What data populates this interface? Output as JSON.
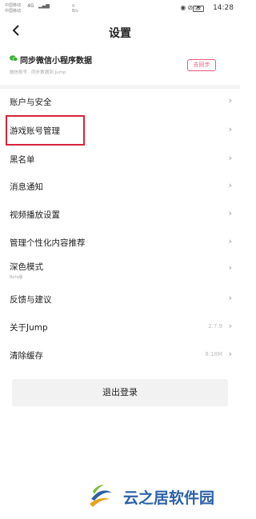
{
  "status_bar": {
    "carrier_1": "中国移动",
    "carrier_2": "中国移动",
    "signal_1": "4G",
    "net_speed_value": "0",
    "net_speed_unit": "B/s",
    "battery": "42",
    "time": "14:28"
  },
  "header": {
    "back_icon": "chevron-left",
    "title": "设置"
  },
  "sync": {
    "title": "同步微信小程序数据",
    "subtitle": "微信账号 · 同步数据到 Jump",
    "button": "去同步",
    "icon": "wechat-icon"
  },
  "menu": [
    {
      "label": "账户与安全",
      "value": ""
    },
    {
      "label": "游戏账号管理",
      "value": ""
    },
    {
      "label": "黑名单",
      "value": ""
    },
    {
      "label": "消息通知",
      "value": ""
    },
    {
      "label": "视频播放设置",
      "value": ""
    },
    {
      "label": "管理个性化内容推荐",
      "value": ""
    },
    {
      "label": "深色模式",
      "sub": "Beta版",
      "value": ""
    },
    {
      "label": "反馈与建议",
      "value": ""
    },
    {
      "label": "关于Jump",
      "value": "2.7.9"
    },
    {
      "label": "清除缓存",
      "value": "8.18M"
    }
  ],
  "logout": "退出登录",
  "watermark": {
    "text": "云之居软件园"
  },
  "colors": {
    "accent": "#e85a7c",
    "highlight": "#d8223a",
    "watermark_blue": "#2c61a6"
  }
}
